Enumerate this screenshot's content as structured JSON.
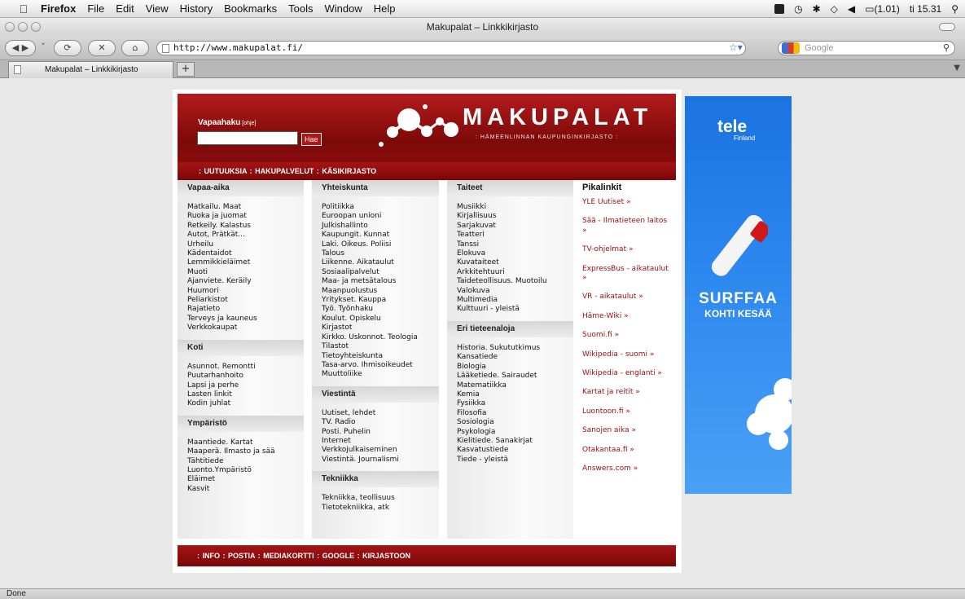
{
  "menubar": {
    "app": "Firefox",
    "items": [
      "File",
      "Edit",
      "View",
      "History",
      "Bookmarks",
      "Tools",
      "Window",
      "Help"
    ],
    "battery": "(1.01)",
    "clock": "ti 15.31"
  },
  "window": {
    "title": "Makupalat – Linkkikirjasto"
  },
  "toolbar": {
    "url": "http://www.makupalat.fi/",
    "search_placeholder": "Google"
  },
  "tab": {
    "label": "Makupalat – Linkkikirjasto",
    "new_tab": "+"
  },
  "status": "Done",
  "header": {
    "search_label": "Vapaahaku",
    "help": "[ohje]",
    "search_button": "Hae",
    "logo": "MAKUPALAT",
    "subtitle": ": Hämeenlinnan Kaupunginkirjasto :",
    "nav": ": UUTUUKSIA  : HAKUPALVELUT  : KÄSIKIRJASTO"
  },
  "col1": [
    {
      "title": "Vapaa-aika",
      "items": [
        "Matkailu. Maat",
        "Ruoka ja juomat",
        "Retkeily. Kalastus",
        "Autot, Prätkät...",
        "Urheilu",
        "Kädentaidot",
        "Lemmikkieläimet",
        "Muoti",
        "Ajanviete. Keräily",
        "Huumori",
        "Peliarkistot",
        "Rajatieto",
        "Terveys ja kauneus",
        "Verkkokaupat"
      ]
    },
    {
      "title": "Koti",
      "items": [
        "Asunnot. Remontti",
        "Puutarhanhoito",
        "Lapsi ja perhe",
        "Lasten linkit",
        "Kodin juhlat"
      ]
    },
    {
      "title": "Ympäristö",
      "items": [
        "Maantiede. Kartat",
        "Maaperä. Ilmasto ja sää",
        "Tähtitiede",
        "Luonto.Ympäristö",
        "Eläimet",
        "Kasvit"
      ]
    }
  ],
  "col2": [
    {
      "title": "Yhteiskunta",
      "items": [
        "Politiikka",
        "Euroopan unioni",
        "Julkishallinto",
        "Kaupungit. Kunnat",
        "Laki. Oikeus. Poliisi",
        "Talous",
        "Liikenne. Aikataulut",
        "Sosiaalipalvelut",
        "Maa- ja metsätalous",
        "Maanpuolustus",
        "Yritykset. Kauppa",
        "Työ. Työnhaku",
        "Koulut. Opiskelu",
        "Kirjastot",
        "Kirkko. Uskonnot. Teologia",
        "Tilastot",
        "Tietoyhteiskunta",
        "Tasa-arvo. Ihmisoikeudet",
        "Muuttoliike"
      ]
    },
    {
      "title": "Viestintä",
      "items": [
        "Uutiset, lehdet",
        "TV. Radio",
        "Posti. Puhelin",
        "Internet",
        "Verkkojulkaiseminen",
        "Viestintä. Journalismi"
      ]
    },
    {
      "title": "Tekniikka",
      "items": [
        "Tekniikka, teollisuus",
        "Tietotekniikka, atk"
      ]
    }
  ],
  "col3": [
    {
      "title": "Taiteet",
      "items": [
        "Musiikki",
        "Kirjallisuus",
        "Sarjakuvat",
        "Teatteri",
        "Tanssi",
        "Elokuva",
        "Kuvataiteet",
        "Arkkitehtuuri",
        "Taideteollisuus. Muotoilu",
        "Valokuva",
        "Multimedia",
        "Kulttuuri - yleistä"
      ]
    },
    {
      "title": "Eri tieteenaloja",
      "items": [
        "Historia. Sukututkimus",
        "Kansatiede",
        "Biologia",
        "Lääketiede. Sairaudet",
        "Matematiikka",
        "Kemia",
        "Fysiikka",
        "Filosofia",
        "Sosiologia",
        "Psykologia",
        "Kielitiede. Sanakirjat",
        "Kasvatustiede",
        "Tiede - yleistä"
      ]
    }
  ],
  "pikalinkit": {
    "title": "Pikalinkit",
    "items": [
      "YLE Uutiset »",
      "Sää - Ilmatieteen laitos »",
      "TV-ohjelmat »",
      "ExpressBus - aikataulut »",
      "VR - aikataulut »",
      "Häme-Wiki »",
      "Suomi.fi »",
      "Wikipedia - suomi »",
      "Wikipedia - englanti »",
      "Kartat ja reitit »",
      "Luontoon.fi »",
      "Sanojen aika »",
      "Otakantaa.fi »",
      "Answers.com »"
    ]
  },
  "footer": ": INFO  : POSTIA  : MEDIAKORTTI  : GOOGLE  : KIRJASTOON",
  "ad": {
    "brand": "tele",
    "brand_sub": "Finland",
    "line1": "SURFFAA",
    "line2": "KOHTI KESÄÄ"
  }
}
